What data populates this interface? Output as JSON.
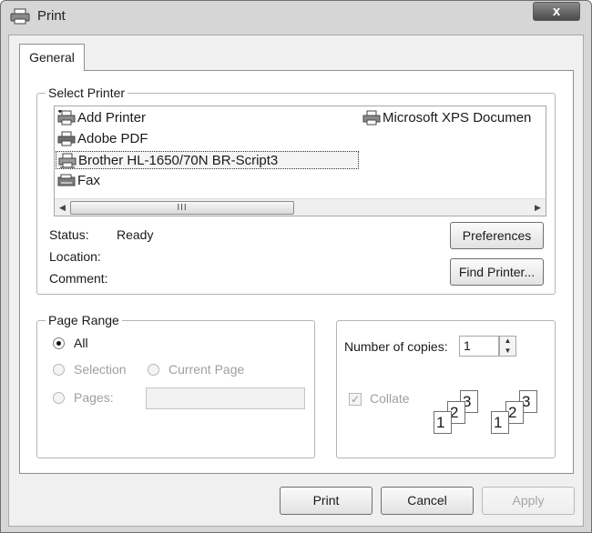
{
  "window": {
    "title": "Print",
    "close_label": "x"
  },
  "tabs": [
    {
      "label": "General"
    }
  ],
  "select_printer": {
    "legend": "Select Printer",
    "printers": [
      {
        "label": "Add Printer",
        "icon": "add-printer-icon"
      },
      {
        "label": "Adobe PDF",
        "icon": "printer-icon"
      },
      {
        "label": "Brother HL-1650/70N BR-Script3",
        "icon": "network-printer-icon",
        "selected": true
      },
      {
        "label": "Fax",
        "icon": "fax-icon"
      },
      {
        "label": "Microsoft XPS Documen",
        "icon": "printer-icon"
      }
    ],
    "scroll_thumb_grip": "III",
    "status_label": "Status:",
    "status_value": "Ready",
    "location_label": "Location:",
    "comment_label": "Comment:",
    "preferences_button": "Preferences",
    "find_printer_button": "Find Printer..."
  },
  "page_range": {
    "legend": "Page Range",
    "all_label": "All",
    "selection_label": "Selection",
    "current_page_label": "Current Page",
    "pages_label": "Pages:",
    "selected_option": "All"
  },
  "copies": {
    "label": "Number of copies:",
    "value": "1",
    "collate_label": "Collate",
    "collate_checked": true,
    "collate_numbers": [
      "1",
      "2",
      "3"
    ]
  },
  "buttons": {
    "print": "Print",
    "cancel": "Cancel",
    "apply": "Apply"
  }
}
